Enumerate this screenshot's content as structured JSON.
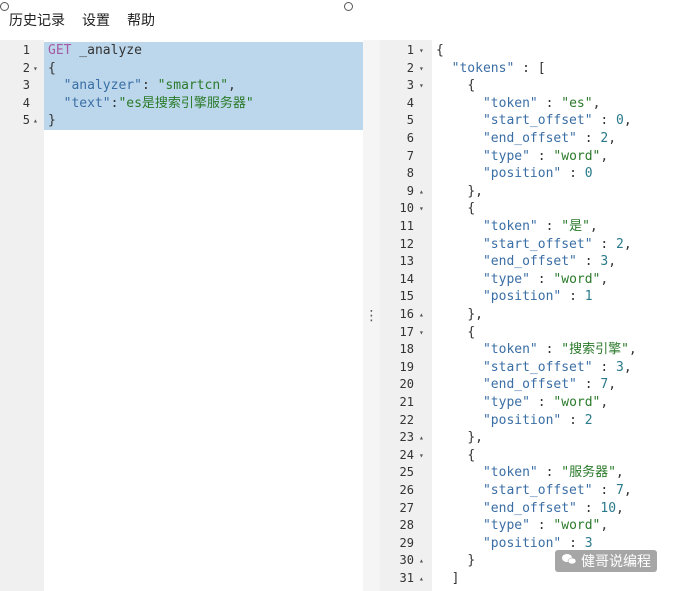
{
  "menu": {
    "items": [
      "历史记录",
      "设置",
      "帮助"
    ]
  },
  "request": {
    "lines": [
      {
        "n": "1",
        "fold": "",
        "parts": [
          [
            "k-method",
            "GET"
          ],
          [
            "k-plain",
            " _analyze"
          ]
        ]
      },
      {
        "n": "2",
        "fold": "▾",
        "parts": [
          [
            "k-punct",
            "{"
          ]
        ]
      },
      {
        "n": "3",
        "fold": "",
        "parts": [
          [
            "k-plain",
            "  "
          ],
          [
            "k-key",
            "\"analyzer\""
          ],
          [
            "k-punct",
            ": "
          ],
          [
            "k-str",
            "\"smartcn\""
          ],
          [
            "k-punct",
            ","
          ]
        ]
      },
      {
        "n": "4",
        "fold": "",
        "parts": [
          [
            "k-plain",
            "  "
          ],
          [
            "k-key",
            "\"text\""
          ],
          [
            "k-punct",
            ":"
          ],
          [
            "k-str",
            "\"es是搜索引擎服务器\""
          ]
        ]
      },
      {
        "n": "5",
        "fold": "▴",
        "parts": [
          [
            "k-punct",
            "}"
          ]
        ]
      }
    ]
  },
  "response": {
    "lines": [
      {
        "n": "1",
        "fold": "▾",
        "parts": [
          [
            "k-punct",
            "{"
          ]
        ]
      },
      {
        "n": "2",
        "fold": "▾",
        "parts": [
          [
            "k-plain",
            "  "
          ],
          [
            "k-key",
            "\"tokens\""
          ],
          [
            "k-punct",
            " : ["
          ]
        ]
      },
      {
        "n": "3",
        "fold": "▾",
        "parts": [
          [
            "k-plain",
            "    "
          ],
          [
            "k-punct",
            "{"
          ]
        ]
      },
      {
        "n": "4",
        "fold": "",
        "parts": [
          [
            "k-plain",
            "      "
          ],
          [
            "k-key",
            "\"token\""
          ],
          [
            "k-punct",
            " : "
          ],
          [
            "k-str",
            "\"es\""
          ],
          [
            "k-punct",
            ","
          ]
        ]
      },
      {
        "n": "5",
        "fold": "",
        "parts": [
          [
            "k-plain",
            "      "
          ],
          [
            "k-key",
            "\"start_offset\""
          ],
          [
            "k-punct",
            " : "
          ],
          [
            "k-num",
            "0"
          ],
          [
            "k-punct",
            ","
          ]
        ]
      },
      {
        "n": "6",
        "fold": "",
        "parts": [
          [
            "k-plain",
            "      "
          ],
          [
            "k-key",
            "\"end_offset\""
          ],
          [
            "k-punct",
            " : "
          ],
          [
            "k-num",
            "2"
          ],
          [
            "k-punct",
            ","
          ]
        ]
      },
      {
        "n": "7",
        "fold": "",
        "parts": [
          [
            "k-plain",
            "      "
          ],
          [
            "k-key",
            "\"type\""
          ],
          [
            "k-punct",
            " : "
          ],
          [
            "k-str",
            "\"word\""
          ],
          [
            "k-punct",
            ","
          ]
        ]
      },
      {
        "n": "8",
        "fold": "",
        "parts": [
          [
            "k-plain",
            "      "
          ],
          [
            "k-key",
            "\"position\""
          ],
          [
            "k-punct",
            " : "
          ],
          [
            "k-num",
            "0"
          ]
        ]
      },
      {
        "n": "9",
        "fold": "▴",
        "parts": [
          [
            "k-plain",
            "    "
          ],
          [
            "k-punct",
            "},"
          ]
        ]
      },
      {
        "n": "10",
        "fold": "▾",
        "parts": [
          [
            "k-plain",
            "    "
          ],
          [
            "k-punct",
            "{"
          ]
        ]
      },
      {
        "n": "11",
        "fold": "",
        "parts": [
          [
            "k-plain",
            "      "
          ],
          [
            "k-key",
            "\"token\""
          ],
          [
            "k-punct",
            " : "
          ],
          [
            "k-str",
            "\"是\""
          ],
          [
            "k-punct",
            ","
          ]
        ]
      },
      {
        "n": "12",
        "fold": "",
        "parts": [
          [
            "k-plain",
            "      "
          ],
          [
            "k-key",
            "\"start_offset\""
          ],
          [
            "k-punct",
            " : "
          ],
          [
            "k-num",
            "2"
          ],
          [
            "k-punct",
            ","
          ]
        ]
      },
      {
        "n": "13",
        "fold": "",
        "parts": [
          [
            "k-plain",
            "      "
          ],
          [
            "k-key",
            "\"end_offset\""
          ],
          [
            "k-punct",
            " : "
          ],
          [
            "k-num",
            "3"
          ],
          [
            "k-punct",
            ","
          ]
        ]
      },
      {
        "n": "14",
        "fold": "",
        "parts": [
          [
            "k-plain",
            "      "
          ],
          [
            "k-key",
            "\"type\""
          ],
          [
            "k-punct",
            " : "
          ],
          [
            "k-str",
            "\"word\""
          ],
          [
            "k-punct",
            ","
          ]
        ]
      },
      {
        "n": "15",
        "fold": "",
        "parts": [
          [
            "k-plain",
            "      "
          ],
          [
            "k-key",
            "\"position\""
          ],
          [
            "k-punct",
            " : "
          ],
          [
            "k-num",
            "1"
          ]
        ]
      },
      {
        "n": "16",
        "fold": "▴",
        "parts": [
          [
            "k-plain",
            "    "
          ],
          [
            "k-punct",
            "},"
          ]
        ]
      },
      {
        "n": "17",
        "fold": "▾",
        "parts": [
          [
            "k-plain",
            "    "
          ],
          [
            "k-punct",
            "{"
          ]
        ]
      },
      {
        "n": "18",
        "fold": "",
        "parts": [
          [
            "k-plain",
            "      "
          ],
          [
            "k-key",
            "\"token\""
          ],
          [
            "k-punct",
            " : "
          ],
          [
            "k-str",
            "\"搜索引擎\""
          ],
          [
            "k-punct",
            ","
          ]
        ]
      },
      {
        "n": "19",
        "fold": "",
        "parts": [
          [
            "k-plain",
            "      "
          ],
          [
            "k-key",
            "\"start_offset\""
          ],
          [
            "k-punct",
            " : "
          ],
          [
            "k-num",
            "3"
          ],
          [
            "k-punct",
            ","
          ]
        ]
      },
      {
        "n": "20",
        "fold": "",
        "parts": [
          [
            "k-plain",
            "      "
          ],
          [
            "k-key",
            "\"end_offset\""
          ],
          [
            "k-punct",
            " : "
          ],
          [
            "k-num",
            "7"
          ],
          [
            "k-punct",
            ","
          ]
        ]
      },
      {
        "n": "21",
        "fold": "",
        "parts": [
          [
            "k-plain",
            "      "
          ],
          [
            "k-key",
            "\"type\""
          ],
          [
            "k-punct",
            " : "
          ],
          [
            "k-str",
            "\"word\""
          ],
          [
            "k-punct",
            ","
          ]
        ]
      },
      {
        "n": "22",
        "fold": "",
        "parts": [
          [
            "k-plain",
            "      "
          ],
          [
            "k-key",
            "\"position\""
          ],
          [
            "k-punct",
            " : "
          ],
          [
            "k-num",
            "2"
          ]
        ]
      },
      {
        "n": "23",
        "fold": "▴",
        "parts": [
          [
            "k-plain",
            "    "
          ],
          [
            "k-punct",
            "},"
          ]
        ]
      },
      {
        "n": "24",
        "fold": "▾",
        "parts": [
          [
            "k-plain",
            "    "
          ],
          [
            "k-punct",
            "{"
          ]
        ]
      },
      {
        "n": "25",
        "fold": "",
        "parts": [
          [
            "k-plain",
            "      "
          ],
          [
            "k-key",
            "\"token\""
          ],
          [
            "k-punct",
            " : "
          ],
          [
            "k-str",
            "\"服务器\""
          ],
          [
            "k-punct",
            ","
          ]
        ]
      },
      {
        "n": "26",
        "fold": "",
        "parts": [
          [
            "k-plain",
            "      "
          ],
          [
            "k-key",
            "\"start_offset\""
          ],
          [
            "k-punct",
            " : "
          ],
          [
            "k-num",
            "7"
          ],
          [
            "k-punct",
            ","
          ]
        ]
      },
      {
        "n": "27",
        "fold": "",
        "parts": [
          [
            "k-plain",
            "      "
          ],
          [
            "k-key",
            "\"end_offset\""
          ],
          [
            "k-punct",
            " : "
          ],
          [
            "k-num",
            "10"
          ],
          [
            "k-punct",
            ","
          ]
        ]
      },
      {
        "n": "28",
        "fold": "",
        "parts": [
          [
            "k-plain",
            "      "
          ],
          [
            "k-key",
            "\"type\""
          ],
          [
            "k-punct",
            " : "
          ],
          [
            "k-str",
            "\"word\""
          ],
          [
            "k-punct",
            ","
          ]
        ]
      },
      {
        "n": "29",
        "fold": "",
        "parts": [
          [
            "k-plain",
            "      "
          ],
          [
            "k-key",
            "\"position\""
          ],
          [
            "k-punct",
            " : "
          ],
          [
            "k-num",
            "3"
          ]
        ]
      },
      {
        "n": "30",
        "fold": "▴",
        "parts": [
          [
            "k-plain",
            "    "
          ],
          [
            "k-punct",
            "}"
          ]
        ]
      },
      {
        "n": "31",
        "fold": "▴",
        "parts": [
          [
            "k-plain",
            "  "
          ],
          [
            "k-punct",
            "]"
          ]
        ]
      }
    ]
  },
  "icons": {
    "run": "play-icon",
    "settings": "wrench-icon",
    "splitter": "vertical-dots-icon",
    "watermark": "wechat-icon"
  },
  "watermark": {
    "text": "健哥说编程"
  },
  "colors": {
    "selection": "#bcd7eb",
    "string": "#2a7a2a",
    "key": "#3a6ea5",
    "method": "#a45aa4"
  }
}
